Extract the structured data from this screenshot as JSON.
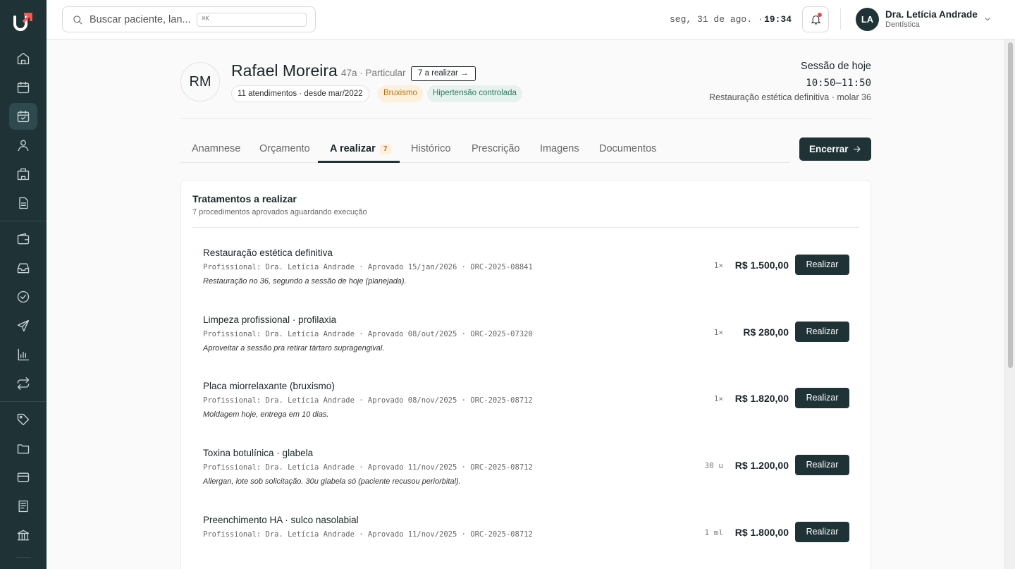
{
  "sidebar": {
    "logo": "logo-mark",
    "items": [
      {
        "icon": "home-icon",
        "active": false
      },
      {
        "icon": "calendar-icon",
        "active": false
      },
      {
        "icon": "calendar-check-icon",
        "active": true
      },
      {
        "icon": "user-icon",
        "active": false
      },
      {
        "icon": "building-icon",
        "active": false
      },
      {
        "icon": "document-icon",
        "active": false
      },
      {
        "icon": "wallet-icon",
        "active": false
      },
      {
        "icon": "inbox-icon",
        "active": false
      },
      {
        "icon": "check-circle-icon",
        "active": false
      },
      {
        "icon": "send-icon",
        "active": false
      },
      {
        "icon": "bar-chart-icon",
        "active": false
      },
      {
        "icon": "repeat-icon",
        "active": false
      },
      {
        "icon": "tag-icon",
        "active": false
      },
      {
        "icon": "folder-icon",
        "active": false
      },
      {
        "icon": "credit-card-icon",
        "active": false
      },
      {
        "icon": "receipt-icon",
        "active": false
      },
      {
        "icon": "bank-icon",
        "active": false
      }
    ]
  },
  "topbar": {
    "search_placeholder": "Buscar paciente, lan...",
    "search_shortcut": "⌘K",
    "date": "seg, 31 de ago.",
    "date_separator": "·",
    "time": "19:34",
    "user": {
      "initials": "LA",
      "name": "Dra. Letícia Andrade",
      "role": "Dentística"
    }
  },
  "patient": {
    "initials": "RM",
    "name": "Rafael Moreira",
    "meta": "47a · Particular",
    "pending_button": "7 a realizar →",
    "visits": "11 atendimentos · desde mar/2022",
    "tags": [
      "Bruxismo",
      "Hipertensão controlada"
    ]
  },
  "session": {
    "label": "Sessão de hoje",
    "time": "10:50–11:50",
    "description": "Restauração estética definitiva · molar 36"
  },
  "tabs": [
    {
      "label": "Anamnese",
      "active": false
    },
    {
      "label": "Orçamento",
      "active": false
    },
    {
      "label": "A realizar",
      "active": true,
      "badge": "7"
    },
    {
      "label": "Histórico",
      "active": false
    },
    {
      "label": "Prescrição",
      "active": false
    },
    {
      "label": "Imagens",
      "active": false
    },
    {
      "label": "Documentos",
      "active": false
    }
  ],
  "close_button": "Encerrar",
  "card": {
    "title": "Tratamentos a realizar",
    "subtitle": "7 procedimentos aprovados aguardando execução",
    "action_label": "Realizar",
    "rows": [
      {
        "title": "Restauração estética definitiva",
        "meta": "Profissional: Dra. Letícia Andrade · Aprovado 15/jan/2026 · ORC-2025-08841",
        "note": "Restauração no 36, segundo a sessão de hoje (planejada).",
        "qty": "1×",
        "price": "R$ 1.500,00"
      },
      {
        "title": "Limpeza profissional · profilaxia",
        "meta": "Profissional: Dra. Letícia Andrade · Aprovado 08/out/2025 · ORC-2025-07320",
        "note": "Aproveitar a sessão pra retirar tártaro supragengival.",
        "qty": "1×",
        "price": "R$ 280,00"
      },
      {
        "title": "Placa miorrelaxante (bruxismo)",
        "meta": "Profissional: Dra. Letícia Andrade · Aprovado 08/nov/2025 · ORC-2025-08712",
        "note": "Moldagem hoje, entrega em 10 dias.",
        "qty": "1×",
        "price": "R$ 1.820,00"
      },
      {
        "title": "Toxina botulínica · glabela",
        "meta": "Profissional: Dra. Letícia Andrade · Aprovado 11/nov/2025 · ORC-2025-08712",
        "note": "Allergan, lote sob solicitação. 30u glabela só (paciente recusou periorbital).",
        "qty": "30 u",
        "price": "R$ 1.200,00"
      },
      {
        "title": "Preenchimento HA · sulco nasolabial",
        "meta": "Profissional: Dra. Letícia Andrade · Aprovado 11/nov/2025 · ORC-2025-08712",
        "note": "",
        "qty": "1 ml",
        "price": "R$ 1.800,00"
      }
    ]
  }
}
